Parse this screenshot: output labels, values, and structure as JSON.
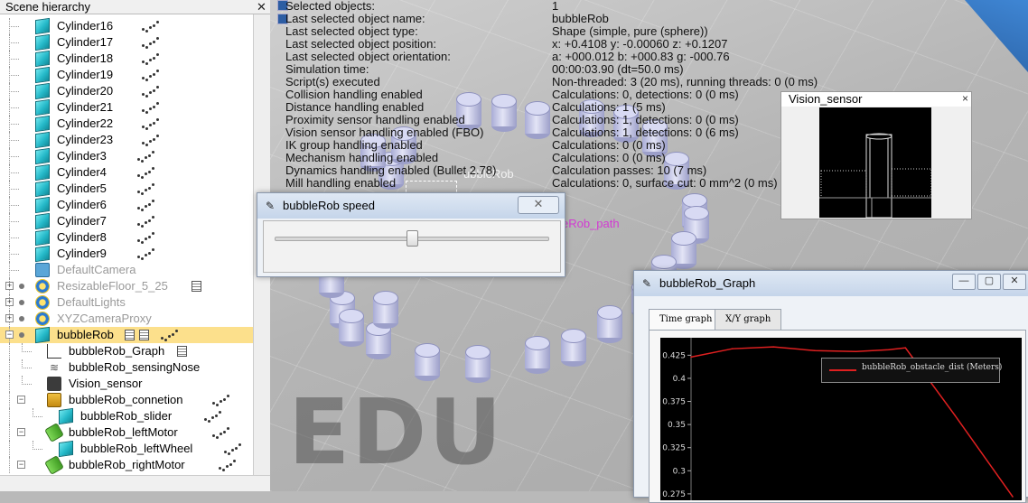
{
  "hierarchy": {
    "title": "Scene hierarchy",
    "rows": [
      {
        "label": "Cylinder16"
      },
      {
        "label": "Cylinder17"
      },
      {
        "label": "Cylinder18"
      },
      {
        "label": "Cylinder19"
      },
      {
        "label": "Cylinder20"
      },
      {
        "label": "Cylinder21"
      },
      {
        "label": "Cylinder22"
      },
      {
        "label": "Cylinder23"
      },
      {
        "label": "Cylinder3"
      },
      {
        "label": "Cylinder4"
      },
      {
        "label": "Cylinder5"
      },
      {
        "label": "Cylinder6"
      },
      {
        "label": "Cylinder7"
      },
      {
        "label": "Cylinder8"
      },
      {
        "label": "Cylinder9"
      },
      {
        "label": "DefaultCamera"
      },
      {
        "label": "ResizableFloor_5_25"
      },
      {
        "label": "DefaultLights"
      },
      {
        "label": "XYZCameraProxy"
      },
      {
        "label": "bubbleRob"
      },
      {
        "label": "bubbleRob_Graph"
      },
      {
        "label": "bubbleRob_sensingNose"
      },
      {
        "label": "Vision_sensor"
      },
      {
        "label": "bubbleRob_connetion"
      },
      {
        "label": "bubbleRob_slider"
      },
      {
        "label": "bubbleRob_leftMotor"
      },
      {
        "label": "bubbleRob_leftWheel"
      },
      {
        "label": "bubbleRob_rightMotor"
      }
    ]
  },
  "info": {
    "rows": [
      {
        "k": "Selected objects:",
        "v": "1"
      },
      {
        "k": "Last selected object name:",
        "v": "bubbleRob"
      },
      {
        "k": "Last selected object type:",
        "v": "Shape (simple, pure (sphere))"
      },
      {
        "k": "Last selected object position:",
        "v": "x: +0.4108   y: -0.00060   z: +0.1207"
      },
      {
        "k": "Last selected object orientation:",
        "v": "a: +000.012   b: +000.83   g: -000.76"
      },
      {
        "k": "Simulation time:",
        "v": "00:00:03.90 (dt=50.0 ms)"
      },
      {
        "k": "Script(s) executed",
        "v": "Non-threaded: 3 (20 ms), running threads: 0 (0 ms)"
      },
      {
        "k": "Collision handling enabled",
        "v": "Calculations: 0, detections: 0 (0 ms)"
      },
      {
        "k": "Distance handling enabled",
        "v": "Calculations: 1 (5 ms)"
      },
      {
        "k": "Proximity sensor handling enabled",
        "v": "Calculations: 1, detections: 0 (0 ms)"
      },
      {
        "k": "Vision sensor handling enabled (FBO)",
        "v": "Calculations: 1, detections: 0 (6 ms)"
      },
      {
        "k": "IK group handling enabled",
        "v": "Calculations: 0 (0 ms)"
      },
      {
        "k": "Mechanism handling enabled",
        "v": "Calculations: 0 (0 ms)"
      },
      {
        "k": "Dynamics handling enabled (Bullet 2.78)",
        "v": "Calculation passes: 10 (7 ms)"
      },
      {
        "k": "Mill handling enabled",
        "v": "Calculations: 0, surface cut: 0 mm^2 (0 ms)"
      }
    ]
  },
  "viewport": {
    "watermark": "EDU",
    "path_label": "eRob_path",
    "robot_label": "ubbleRob"
  },
  "vision_sensor_window": {
    "title": "Vision_sensor",
    "close": "×"
  },
  "speed_window": {
    "title": "bubbleRob speed",
    "slider_value_fraction": 0.5
  },
  "graph_window": {
    "title": "bubbleRob_Graph",
    "tabs": [
      "Time graph",
      "X/Y graph"
    ],
    "active_tab": "Time graph"
  },
  "chart_data": {
    "type": "line",
    "series": [
      {
        "name": "bubbleRob_obstacle_dist (Meters)",
        "color": "#e02020",
        "x": [
          0,
          0.5,
          1,
          1.5,
          2,
          2.4,
          2.6,
          3.2,
          3.9
        ],
        "values": [
          0.423,
          0.432,
          0.434,
          0.43,
          0.429,
          0.431,
          0.433,
          0.36,
          0.272
        ]
      }
    ],
    "yticks": [
      0.425,
      0.4,
      0.375,
      0.35,
      0.325,
      0.3,
      0.275
    ],
    "ylim": [
      0.27,
      0.44
    ],
    "xlim": [
      0,
      3.9
    ],
    "legend_position": "top-right",
    "background": "#000000"
  }
}
